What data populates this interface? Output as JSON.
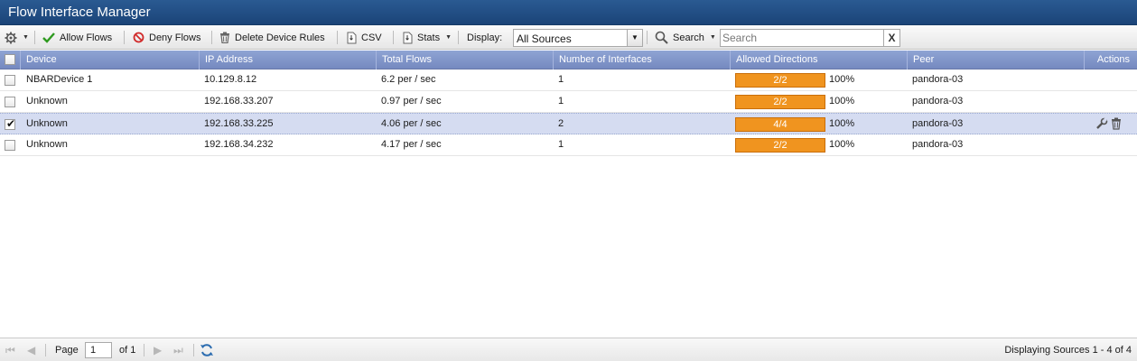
{
  "window": {
    "title": "Flow Interface Manager"
  },
  "toolbar": {
    "settings_icon": "gear-icon",
    "allow_label": "Allow Flows",
    "deny_label": "Deny Flows",
    "delete_label": "Delete Device Rules",
    "csv_label": "CSV",
    "stats_label": "Stats",
    "display_label": "Display:",
    "display_value": "All Sources",
    "search_label": "Search",
    "search_placeholder": "Search",
    "clear_label": "X",
    "colors": {
      "allow": "#2e9a1f",
      "deny": "#d12a2a"
    }
  },
  "grid": {
    "columns": [
      "Device",
      "IP Address",
      "Total Flows",
      "Number of Interfaces",
      "Allowed Directions",
      "Peer",
      "Actions"
    ],
    "rows": [
      {
        "checked": false,
        "device": "NBARDevice 1",
        "ip": "10.129.8.12",
        "flows": "6.2 per / sec",
        "interfaces": "1",
        "directions": "2/2",
        "directions_fraction": 1.0,
        "percent": "100%",
        "peer": "pandora-03",
        "show_actions": false
      },
      {
        "checked": false,
        "device": "Unknown",
        "ip": "192.168.33.207",
        "flows": "0.97 per / sec",
        "interfaces": "1",
        "directions": "2/2",
        "directions_fraction": 1.0,
        "percent": "100%",
        "peer": "pandora-03",
        "show_actions": false
      },
      {
        "checked": true,
        "device": "Unknown",
        "ip": "192.168.33.225",
        "flows": "4.06 per / sec",
        "interfaces": "2",
        "directions": "4/4",
        "directions_fraction": 1.0,
        "percent": "100%",
        "peer": "pandora-03",
        "show_actions": true
      },
      {
        "checked": false,
        "device": "Unknown",
        "ip": "192.168.34.232",
        "flows": "4.17 per / sec",
        "interfaces": "1",
        "directions": "2/2",
        "directions_fraction": 1.0,
        "percent": "100%",
        "peer": "pandora-03",
        "show_actions": false
      }
    ],
    "bar_color": "#f0941f",
    "selected_row_color": "#d5dcf1"
  },
  "footer": {
    "page_label": "Page",
    "page_value": "1",
    "of_label": "of 1",
    "display_text": "Displaying Sources 1 - 4 of 4"
  }
}
